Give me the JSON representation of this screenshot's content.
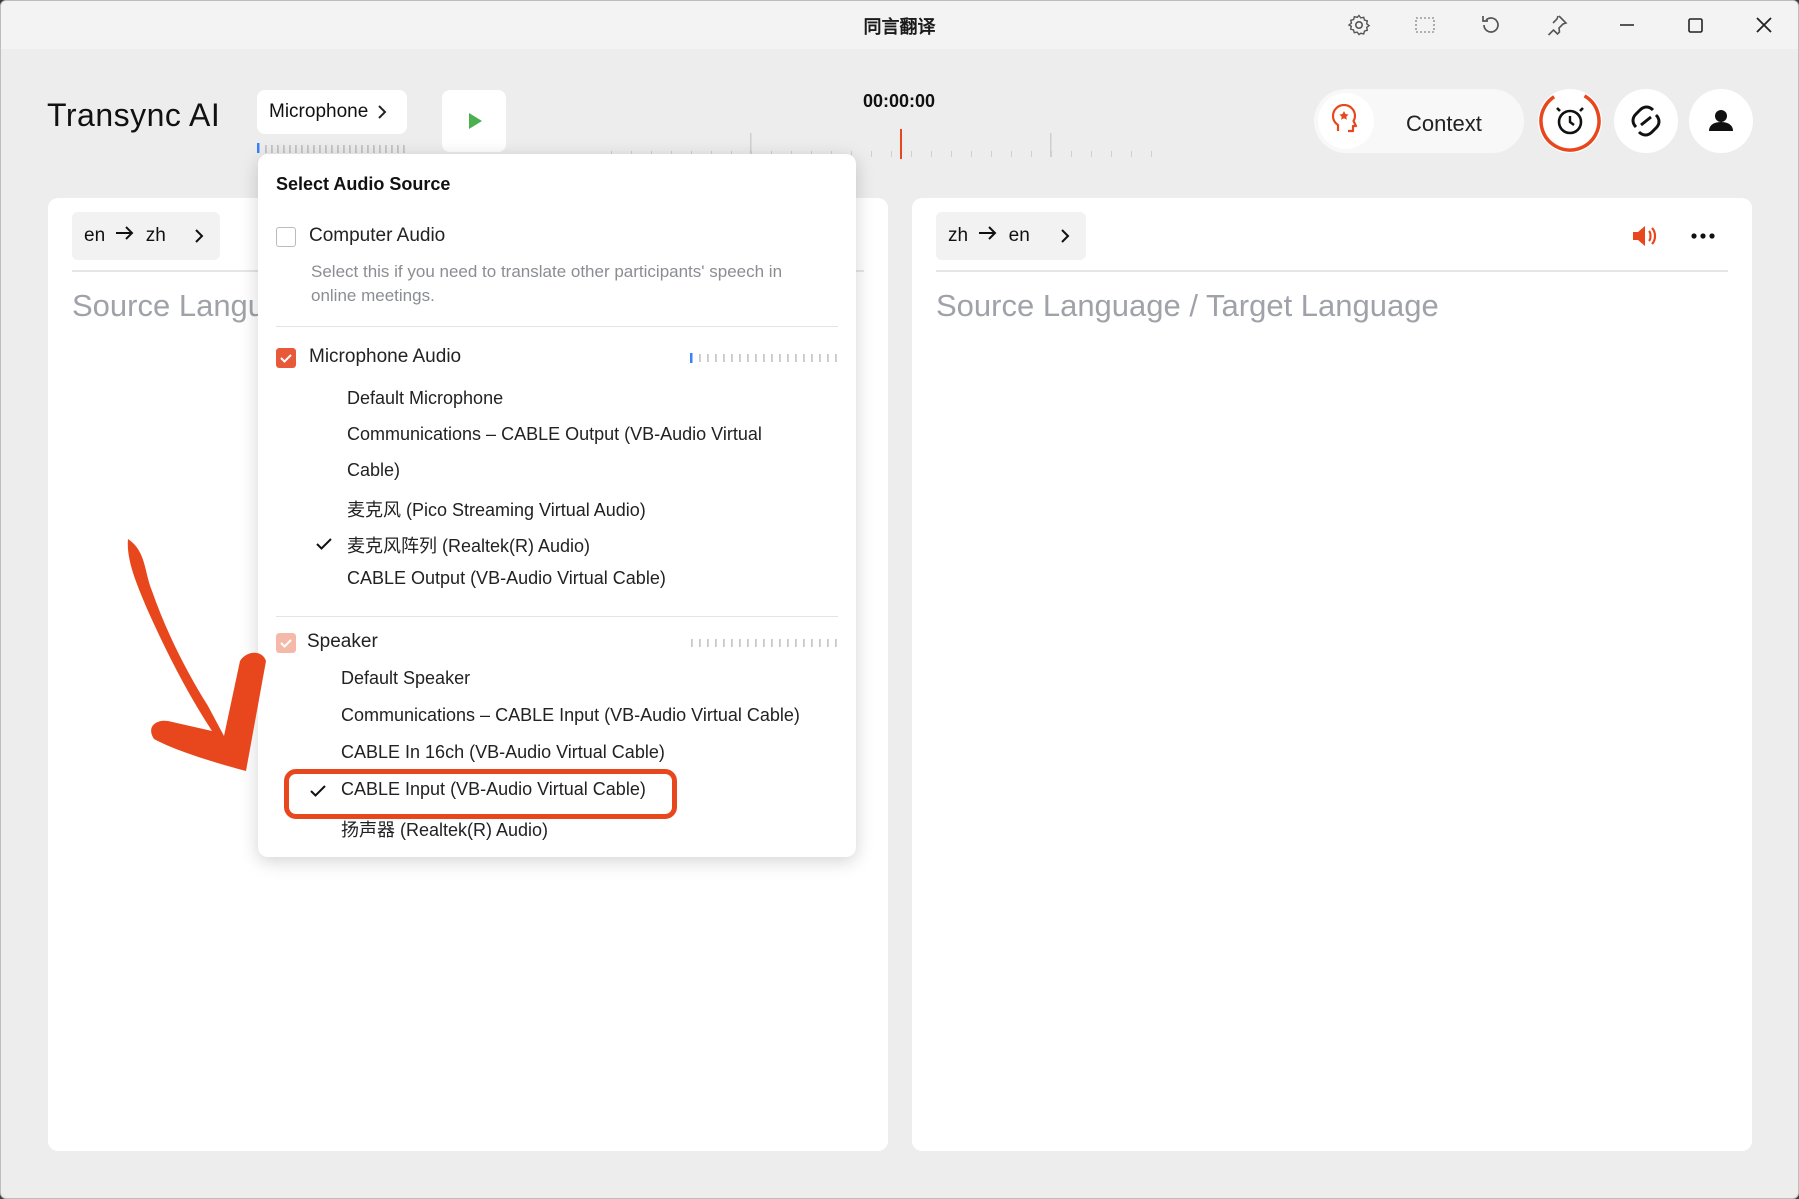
{
  "window": {
    "title": "同言翻译"
  },
  "header": {
    "brand": "Transync AI",
    "source_button": "Microphone",
    "timer": "00:00:00",
    "context_label": "Context"
  },
  "left_panel": {
    "lang_from": "en",
    "lang_to": "zh",
    "placeholder": "Source Langu"
  },
  "right_panel": {
    "lang_from": "zh",
    "lang_to": "en",
    "placeholder": "Source Language / Target Language"
  },
  "popup": {
    "title": "Select Audio Source",
    "computer_audio": {
      "label": "Computer Audio",
      "checked": false,
      "hint": "Select this if you need to translate other participants' speech in online meetings."
    },
    "microphone_audio": {
      "label": "Microphone Audio",
      "checked": true,
      "devices": [
        {
          "name": "Default Microphone",
          "selected": false
        },
        {
          "name": "Communications – CABLE Output (VB-Audio Virtual",
          "selected": false
        },
        {
          "name": "Cable)",
          "selected": false
        },
        {
          "name": "麦克风 (Pico Streaming Virtual Audio)",
          "selected": false
        },
        {
          "name": "麦克风阵列 (Realtek(R) Audio)",
          "selected": true
        },
        {
          "name": "CABLE Output (VB-Audio Virtual Cable)",
          "selected": false
        }
      ]
    },
    "speaker": {
      "label": "Speaker",
      "checked": true,
      "devices": [
        {
          "name": "Default Speaker",
          "selected": false
        },
        {
          "name": "Communications – CABLE Input (VB-Audio Virtual Cable)",
          "selected": false
        },
        {
          "name": "CABLE In 16ch (VB-Audio Virtual Cable)",
          "selected": false
        },
        {
          "name": "CABLE Input (VB-Audio Virtual Cable)",
          "selected": true
        },
        {
          "name": "扬声器 (Realtek(R) Audio)",
          "selected": false
        }
      ]
    }
  },
  "colors": {
    "accent": "#e8471d",
    "play": "#4caf50",
    "meter_active": "#3b82f6",
    "checkbox_checked": "#e8593a",
    "checkbox_disabled": "#f4b9a8"
  }
}
